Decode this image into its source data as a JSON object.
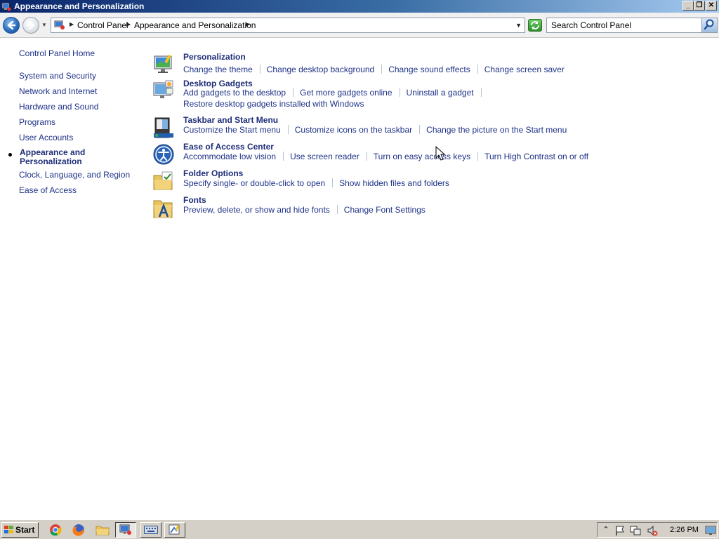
{
  "window": {
    "title": "Appearance and Personalization"
  },
  "window_controls": {
    "minimize": "_",
    "maximize": "❐",
    "close": "✕"
  },
  "address": {
    "crumbs": [
      "Control Panel",
      "Appearance and Personalization"
    ],
    "search_placeholder": "Search Control Panel"
  },
  "sidebar": {
    "items": [
      {
        "label": "Control Panel Home"
      },
      {
        "label": "System and Security"
      },
      {
        "label": "Network and Internet"
      },
      {
        "label": "Hardware and Sound"
      },
      {
        "label": "Programs"
      },
      {
        "label": "User Accounts"
      },
      {
        "label": "Appearance and Personalization",
        "current": true
      },
      {
        "label": "Clock, Language, and Region"
      },
      {
        "label": "Ease of Access"
      }
    ]
  },
  "sections": [
    {
      "title": "Personalization",
      "icon": "personalization-icon",
      "links": [
        [
          "Change the theme",
          "Change desktop background",
          "Change sound effects",
          "Change screen saver"
        ]
      ]
    },
    {
      "title": "Desktop Gadgets",
      "icon": "desktop-gadgets-icon",
      "links": [
        [
          "Add gadgets to the desktop",
          "Get more gadgets online",
          "Uninstall a gadget"
        ],
        [
          "Restore desktop gadgets installed with Windows"
        ]
      ]
    },
    {
      "title": "Taskbar and Start Menu",
      "icon": "taskbar-icon",
      "links": [
        [
          "Customize the Start menu",
          "Customize icons on the taskbar",
          "Change the picture on the Start menu"
        ]
      ]
    },
    {
      "title": "Ease of Access Center",
      "icon": "ease-of-access-icon",
      "links": [
        [
          "Accommodate low vision",
          "Use screen reader",
          "Turn on easy access keys",
          "Turn High Contrast on or off"
        ]
      ]
    },
    {
      "title": "Folder Options",
      "icon": "folder-options-icon",
      "links": [
        [
          "Specify single- or double-click to open",
          "Show hidden files and folders"
        ]
      ]
    },
    {
      "title": "Fonts",
      "icon": "fonts-icon",
      "links": [
        [
          "Preview, delete, or show and hide fonts",
          "Change Font Settings"
        ]
      ]
    }
  ],
  "taskbar": {
    "start_label": "Start",
    "apps": [
      "chrome-icon",
      "firefox-icon",
      "file-explorer-icon",
      "control-panel-icon",
      "keyboard-icon",
      "paint-icon"
    ],
    "clock": "2:26 PM"
  },
  "colors": {
    "link": "#1e3287",
    "title_bar": "#0a246a",
    "taskbar": "#d4d0c8"
  }
}
